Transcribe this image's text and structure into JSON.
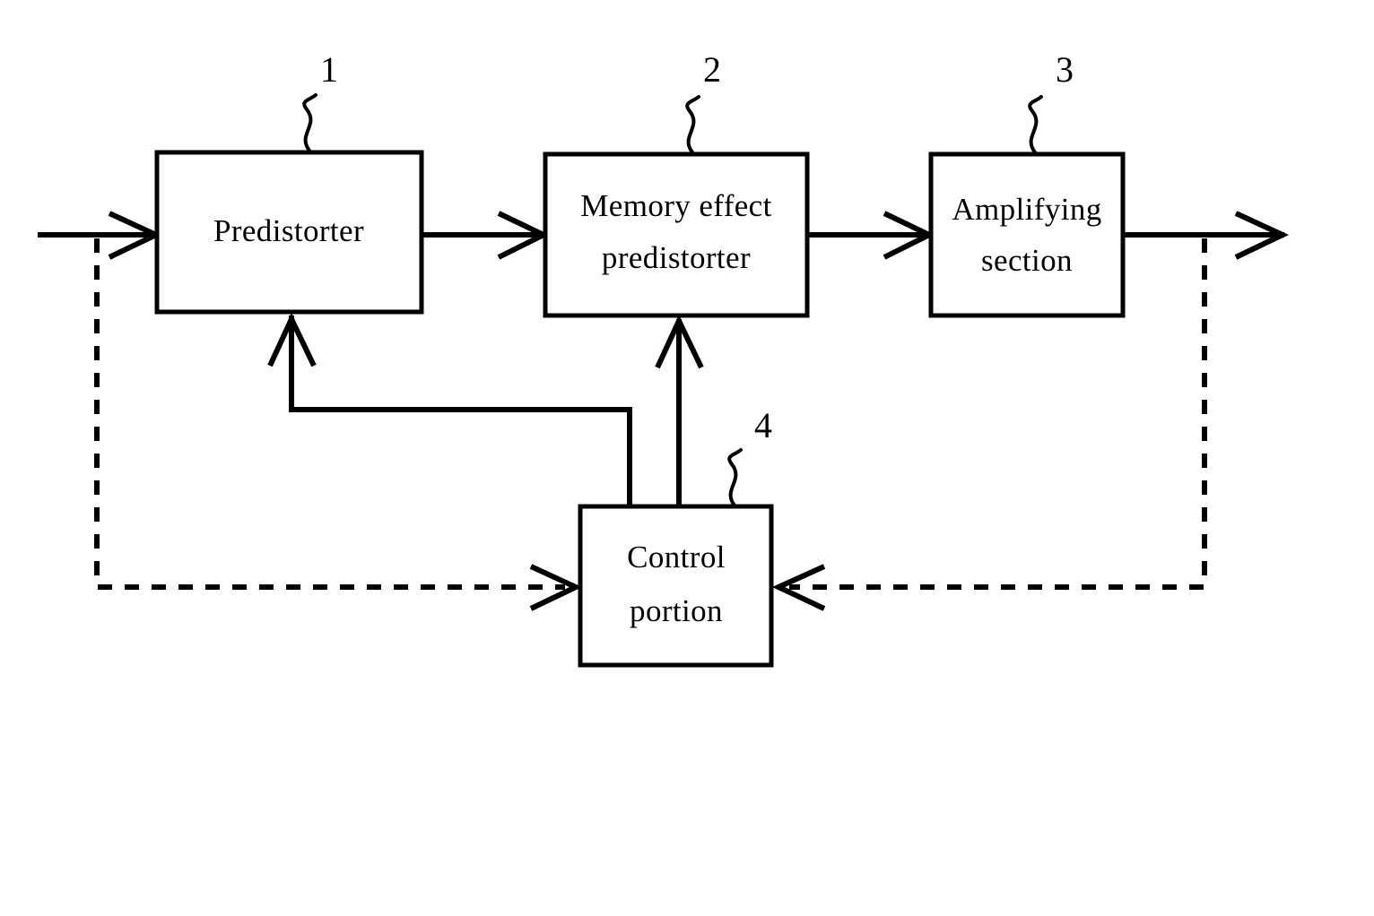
{
  "figure": {
    "type": "block-diagram",
    "background_color": "#ffffff",
    "line_color": "#000000",
    "blocks": [
      {
        "id": "predistorter",
        "label": "Predistorter",
        "label_lines": [
          "Predistorter"
        ],
        "ref": "1"
      },
      {
        "id": "memory-effect",
        "label": "Memory effect predistorter",
        "label_lines": [
          "Memory effect",
          "predistorter"
        ],
        "ref": "2"
      },
      {
        "id": "amplifying-section",
        "label": "Amplifying section",
        "label_lines": [
          "Amplifying",
          "section"
        ],
        "ref": "3"
      },
      {
        "id": "control-portion",
        "label": "Control portion",
        "label_lines": [
          "Control",
          "portion"
        ],
        "ref": "4"
      }
    ],
    "block_labels": {
      "predistorter": "Predistorter",
      "memory_effect_line1": "Memory effect",
      "memory_effect_line2": "predistorter",
      "amplifying_line1": "Amplifying",
      "amplifying_line2": "section",
      "control_line1": "Control",
      "control_line2": "portion"
    },
    "reference_numerals": {
      "predistorter": "1",
      "memory_effect": "2",
      "amplifying_section": "3",
      "control_portion": "4"
    },
    "signal_paths": [
      {
        "from": "input",
        "to": "predistorter",
        "style": "solid",
        "arrow": true
      },
      {
        "from": "predistorter",
        "to": "memory-effect",
        "style": "solid",
        "arrow": true
      },
      {
        "from": "memory-effect",
        "to": "amplifying-section",
        "style": "solid",
        "arrow": true
      },
      {
        "from": "amplifying-section",
        "to": "output",
        "style": "solid",
        "arrow": true
      },
      {
        "from": "control-portion",
        "to": "predistorter",
        "style": "solid",
        "arrow": true
      },
      {
        "from": "control-portion",
        "to": "memory-effect",
        "style": "solid",
        "arrow": true
      },
      {
        "from": "input-tap",
        "to": "control-portion",
        "style": "dashed",
        "arrow": true
      },
      {
        "from": "output-tap",
        "to": "control-portion",
        "style": "dashed",
        "arrow": true
      }
    ]
  }
}
